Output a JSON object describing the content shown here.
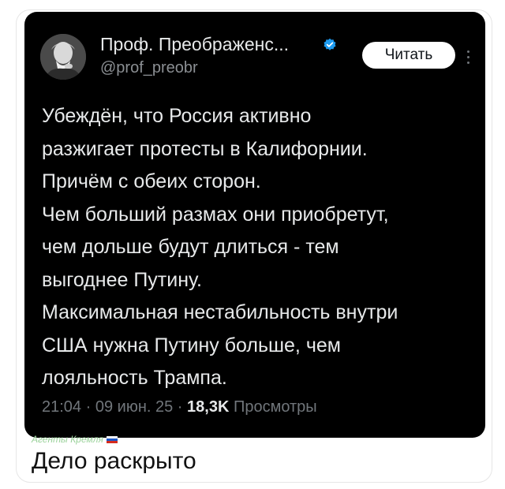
{
  "tweet": {
    "display_name": "Проф. Преображенс...",
    "handle": "@prof_preobr",
    "follow_label": "Читать",
    "avatar_icon": "portrait-avatar",
    "verified_icon": "verified-badge-icon",
    "verified_color": "#1d9bf0",
    "text_lines": [
      "Убеждён, что Россия активно",
      "разжигает протесты в Калифорнии.",
      "Причём с обеих сторон.",
      "Чем больший размах они приобретут,",
      "чем дольше будут длиться - тем",
      "выгоднее Путину.",
      "Максимальная нестабильность внутри",
      "США нужна Путину больше, чем",
      "лояльность Трампа."
    ],
    "time": "21:04",
    "date": "09 июн. 25",
    "views_count": "18,3K",
    "views_label": "Просмотры"
  },
  "caption": {
    "small": "Агенты Кремля",
    "small_icon": "russian-flag-icon",
    "main": "Дело раскрыто"
  }
}
